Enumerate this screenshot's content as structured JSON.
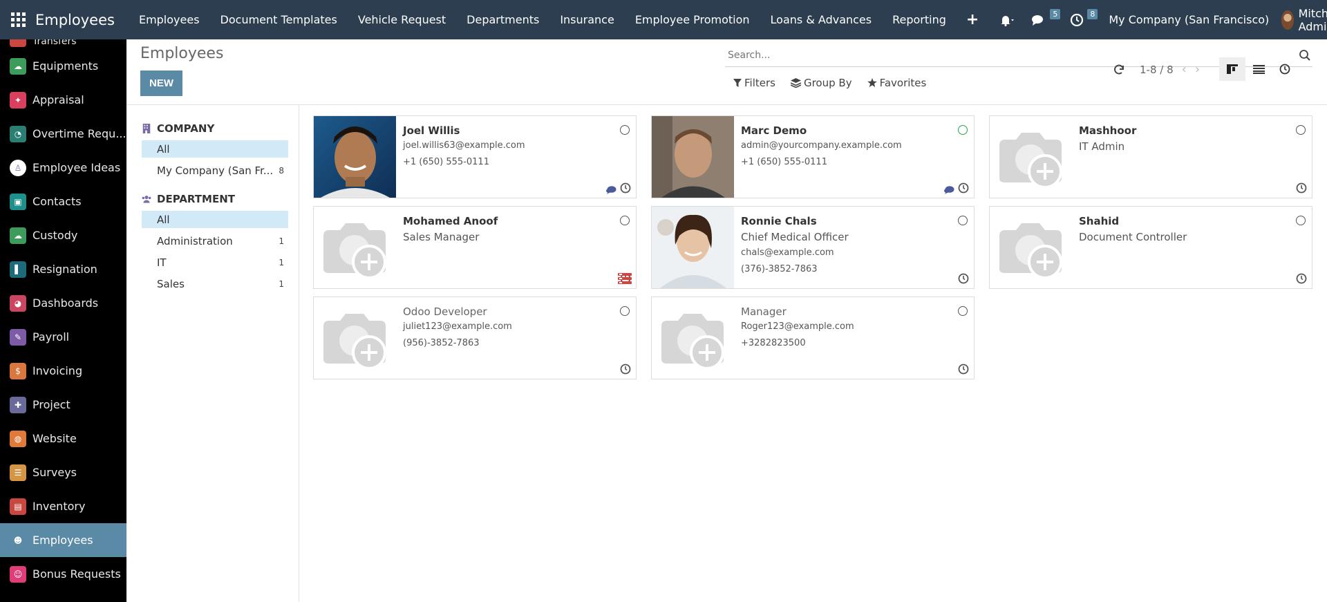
{
  "topbar": {
    "app_title": "Employees",
    "menu": [
      "Employees",
      "Document Templates",
      "Vehicle Request",
      "Departments",
      "Insurance",
      "Employee Promotion",
      "Loans & Advances",
      "Reporting"
    ],
    "plus_label": "+",
    "messages_badge": "5",
    "activities_badge": "8",
    "company": "My Company (San Francisco)",
    "user": "Mitchell Admin"
  },
  "sidebar": {
    "partial_top": "Transfers",
    "items": [
      {
        "label": "Equipments",
        "color": "#3d9b5b",
        "glyph": "☁"
      },
      {
        "label": "Appraisal",
        "color": "#d9405e",
        "glyph": "✦"
      },
      {
        "label": "Overtime Requ...",
        "color": "#2a7f72",
        "glyph": "◔"
      },
      {
        "label": "Employee Ideas",
        "color": "#ffffff",
        "glyph": "♙"
      },
      {
        "label": "Contacts",
        "color": "#1e8f8a",
        "glyph": "▣"
      },
      {
        "label": "Custody",
        "color": "#3d9b5b",
        "glyph": "☁"
      },
      {
        "label": "Resignation",
        "color": "#1d6b7a",
        "glyph": "▌"
      },
      {
        "label": "Dashboards",
        "color": "#c94560",
        "glyph": "◕"
      },
      {
        "label": "Payroll",
        "color": "#7d5ba6",
        "glyph": "✎"
      },
      {
        "label": "Invoicing",
        "color": "#d9773e",
        "glyph": "$"
      },
      {
        "label": "Project",
        "color": "#6a6a9a",
        "glyph": "✚"
      },
      {
        "label": "Website",
        "color": "#e07a3a",
        "glyph": "◍"
      },
      {
        "label": "Surveys",
        "color": "#d49645",
        "glyph": "☰"
      },
      {
        "label": "Inventory",
        "color": "#c9473f",
        "glyph": "▤"
      },
      {
        "label": "Employees",
        "color": "#5b8aa6",
        "glyph": "☻",
        "active": true
      },
      {
        "label": "Bonus Requests",
        "color": "#e03c78",
        "glyph": "☺"
      }
    ]
  },
  "control": {
    "title": "Employees",
    "new_label": "NEW",
    "search_placeholder": "Search...",
    "filters_label": "Filters",
    "groupby_label": "Group By",
    "favorites_label": "Favorites",
    "pager": "1-8 / 8"
  },
  "searchpanel": {
    "company_header": "COMPANY",
    "company_items": [
      {
        "label": "All",
        "count": "",
        "selected": true
      },
      {
        "label": "My Company (San Fr...",
        "count": "8",
        "selected": false
      }
    ],
    "department_header": "DEPARTMENT",
    "department_items": [
      {
        "label": "All",
        "count": "",
        "selected": true
      },
      {
        "label": "Administration",
        "count": "1",
        "selected": false
      },
      {
        "label": "IT",
        "count": "1",
        "selected": false
      },
      {
        "label": "Sales",
        "count": "1",
        "selected": false
      }
    ]
  },
  "employees": [
    {
      "name": "Joel Willis",
      "job": "",
      "email": "joel.willis63@example.com",
      "phone": "+1 (650) 555-0111",
      "photo": "joel",
      "online": false,
      "chat": true,
      "bold": true
    },
    {
      "name": "Marc Demo",
      "job": "",
      "email": "admin@yourcompany.example.com",
      "phone": "+1 (650) 555-0111",
      "photo": "marc",
      "online": true,
      "chat": true,
      "bold": true
    },
    {
      "name": "Mashhoor",
      "job": "IT Admin",
      "email": "",
      "phone": "",
      "photo": "",
      "online": false,
      "chat": false,
      "bold": true
    },
    {
      "name": "Mohamed Anoof",
      "job": "Sales Manager",
      "email": "",
      "phone": "",
      "photo": "",
      "online": false,
      "chat": false,
      "bold": true,
      "list_icon": true
    },
    {
      "name": "Ronnie Chals",
      "job": "Chief Medical Officer",
      "email": "chals@example.com",
      "phone": "(376)-3852-7863",
      "photo": "ronnie",
      "online": false,
      "chat": false,
      "bold": true
    },
    {
      "name": "Shahid",
      "job": "Document Controller",
      "email": "",
      "phone": "",
      "photo": "",
      "online": false,
      "chat": false,
      "bold": true
    },
    {
      "name": "Odoo Developer",
      "job": "",
      "email": "juliet123@example.com",
      "phone": "(956)-3852-7863",
      "photo": "",
      "online": false,
      "chat": false,
      "bold": false
    },
    {
      "name": "Manager",
      "job": "",
      "email": "Roger123@example.com",
      "phone": "+3282823500",
      "photo": "",
      "online": false,
      "chat": false,
      "bold": false
    }
  ]
}
